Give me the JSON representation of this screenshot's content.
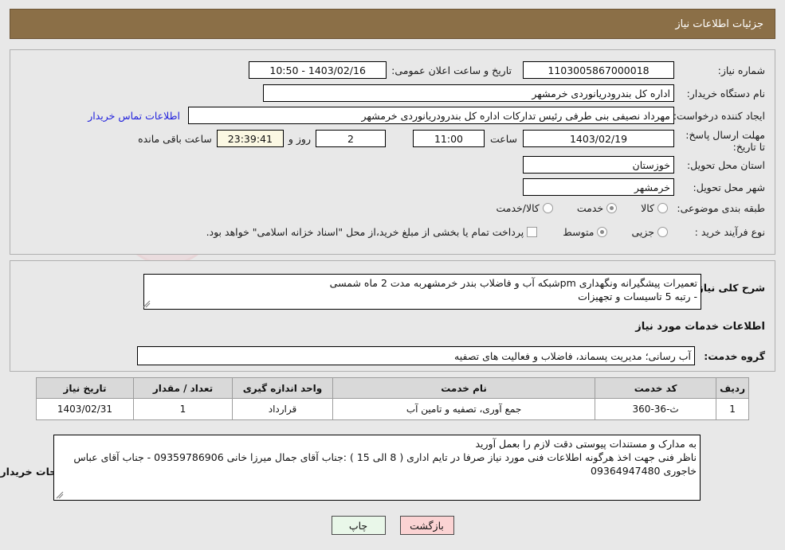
{
  "header": {
    "title": "جزئیات اطلاعات نیاز"
  },
  "main": {
    "need_number": {
      "label": "شماره نیاز:",
      "value": "1103005867000018"
    },
    "public_announce": {
      "label": "تاریخ و ساعت اعلان عمومی:",
      "value": "1403/02/16 - 10:50"
    },
    "buyer_org": {
      "label": "نام دستگاه خریدار:",
      "value": "اداره کل بندرودریانوردی خرمشهر"
    },
    "request_creator": {
      "label": "ایجاد کننده درخواست:",
      "value": "مهرداد  نصیفی بنی طرفی رئیس تدارکات اداره کل بندرودریانوردی خرمشهر",
      "contact_link": "اطلاعات تماس خریدار"
    },
    "deadline": {
      "label": "مهلت ارسال پاسخ: تا تاریخ:",
      "date": "1403/02/19",
      "hour_label": "ساعت",
      "hour": "11:00",
      "days": "2",
      "days_label": "روز و",
      "countdown": "23:39:41",
      "remaining_label": "ساعت باقی مانده"
    },
    "province": {
      "label": "استان محل تحویل:",
      "value": "خوزستان"
    },
    "city": {
      "label": "شهر محل تحویل:",
      "value": "خرمشهر"
    },
    "classification": {
      "label": "طبقه بندی موضوعی:",
      "options": [
        {
          "label": "کالا",
          "selected": false
        },
        {
          "label": "خدمت",
          "selected": true
        },
        {
          "label": "کالا/خدمت",
          "selected": false
        }
      ]
    },
    "purchase_process": {
      "label": "نوع فرآیند خرید :",
      "options": [
        {
          "label": "جزیی",
          "selected": false
        },
        {
          "label": "متوسط",
          "selected": true
        }
      ],
      "treasury_checkbox_label": "پرداخت تمام یا بخشی از مبلغ خرید،از محل \"اسناد خزانه اسلامی\" خواهد بود.",
      "treasury_checked": false
    }
  },
  "description": {
    "general_label": "شرح کلی نیاز:",
    "general_value": "تعمیرات پیشگیرانه ونگهداری pmشبکه آب و فاضلاب بندر خرمشهربه مدت 2 ماه شمسی\n- رتبه 5 تاسیسات و تجهیزات",
    "section_title": "اطلاعات خدمات مورد نیاز",
    "service_group_label": "گروه خدمت:",
    "service_group_value": "آب رسانی؛ مدیریت پسماند، فاضلاب و فعالیت های تصفیه"
  },
  "table": {
    "columns": [
      "ردیف",
      "کد خدمت",
      "نام خدمت",
      "واحد اندازه گیری",
      "تعداد / مقدار",
      "تاریخ نیاز"
    ],
    "rows": [
      {
        "row": "1",
        "code": "ث-36-360",
        "name": "جمع آوری، تصفیه و تامین آب",
        "unit": "قرارداد",
        "qty": "1",
        "date": "1403/02/31"
      }
    ]
  },
  "notes": {
    "label": "توضیحات خریدار:",
    "value": "به مدارک و مستندات پیوستی دقت لازم را بعمل آورید\nناظر فنی جهت اخذ هرگونه اطلاعات فنی مورد نیاز صرفا در تایم اداری ( 8 الی 15 ) :جناب آقای جمال میرزا خانی 09359786906 - جناب آقای عباس خاجوری 09364947480"
  },
  "buttons": {
    "print": "چاپ",
    "back": "بازگشت"
  },
  "colors": {
    "header_bar": "#8b6f47",
    "page_bg": "#e8e8e8",
    "link": "#2222dd",
    "print_btn": "#e9f7e9",
    "back_btn": "#fbd3d3",
    "countdown_bg": "#fbf8e3"
  },
  "watermark": {
    "text": "AriaTender.net"
  }
}
